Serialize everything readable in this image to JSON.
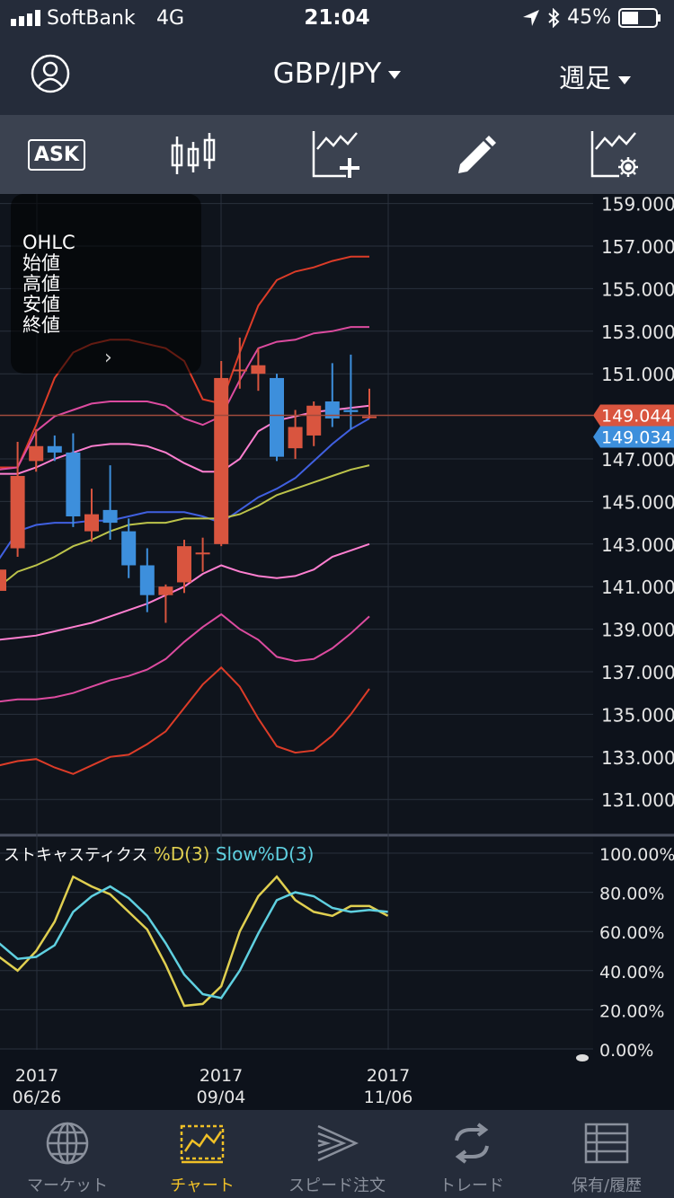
{
  "status": {
    "carrier": "SoftBank",
    "network": "4G",
    "time": "21:04",
    "battery": "45%"
  },
  "header": {
    "pair": "GBP/JPY",
    "period": "週足"
  },
  "toolbar": {
    "ask_label": "ASK"
  },
  "ohlc": {
    "title": "OHLC",
    "open": "始値",
    "high": "高値",
    "low": "安値",
    "close": "終値"
  },
  "price_axis": [
    "159.000",
    "157.000",
    "155.000",
    "153.000",
    "151.000",
    "147.000",
    "145.000",
    "143.000",
    "141.000",
    "139.000",
    "137.000",
    "135.000",
    "133.000",
    "131.000"
  ],
  "price_tags": {
    "ask": "149.044",
    "bid": "149.034",
    "ask_color": "#d9553f",
    "bid_color": "#3d8fdc"
  },
  "stoch_axis": [
    "100.00%",
    "80.00%",
    "60.00%",
    "40.00%",
    "20.00%",
    "0.00%"
  ],
  "stoch_legend": {
    "name": "ストキャスティクス",
    "k": "%D(3)",
    "d": "Slow%D(3)"
  },
  "date_labels": [
    {
      "year": "2017",
      "date": "06/26"
    },
    {
      "year": "2017",
      "date": "09/04"
    },
    {
      "year": "2017",
      "date": "11/06"
    }
  ],
  "tabs": [
    {
      "label": "マーケット",
      "icon": "globe-icon"
    },
    {
      "label": "チャート",
      "icon": "chart-icon"
    },
    {
      "label": "スピード注文",
      "icon": "speed-order-icon"
    },
    {
      "label": "トレード",
      "icon": "trade-icon"
    },
    {
      "label": "保有/履歴",
      "icon": "history-icon"
    }
  ],
  "colors": {
    "bull": "#d9553f",
    "bear": "#3d8fdc",
    "k_line": "#e0cf50",
    "d_line": "#5fd0e0"
  },
  "chart_data": [
    {
      "type": "candlestick",
      "ylim": [
        130,
        160
      ],
      "candles": [
        {
          "o": 140.8,
          "h": 142.2,
          "l": 138.5,
          "c": 141.8
        },
        {
          "o": 142.8,
          "h": 147.8,
          "l": 142.4,
          "c": 146.2
        },
        {
          "o": 146.9,
          "h": 148.4,
          "l": 146.4,
          "c": 147.6
        },
        {
          "o": 147.6,
          "h": 148.1,
          "l": 146.9,
          "c": 147.3
        },
        {
          "o": 147.3,
          "h": 148.2,
          "l": 143.8,
          "c": 144.3
        },
        {
          "o": 143.6,
          "h": 145.6,
          "l": 143.1,
          "c": 144.4
        },
        {
          "o": 144.6,
          "h": 146.7,
          "l": 143.2,
          "c": 144.0
        },
        {
          "o": 143.6,
          "h": 144.2,
          "l": 141.4,
          "c": 142.0
        },
        {
          "o": 142.0,
          "h": 142.8,
          "l": 139.8,
          "c": 140.6
        },
        {
          "o": 140.6,
          "h": 141.1,
          "l": 139.3,
          "c": 141.0
        },
        {
          "o": 141.2,
          "h": 143.2,
          "l": 140.7,
          "c": 142.9
        },
        {
          "o": 142.6,
          "h": 143.3,
          "l": 141.7,
          "c": 142.6
        },
        {
          "o": 143.0,
          "h": 151.6,
          "l": 142.9,
          "c": 150.8
        },
        {
          "o": 151.2,
          "h": 152.7,
          "l": 150.3,
          "c": 151.2
        },
        {
          "o": 151.0,
          "h": 152.2,
          "l": 150.2,
          "c": 151.4
        },
        {
          "o": 150.8,
          "h": 151.0,
          "l": 146.9,
          "c": 147.1
        },
        {
          "o": 147.5,
          "h": 149.3,
          "l": 147.0,
          "c": 148.5
        },
        {
          "o": 148.1,
          "h": 149.7,
          "l": 147.6,
          "c": 149.5
        },
        {
          "o": 149.7,
          "h": 151.5,
          "l": 148.5,
          "c": 148.9
        },
        {
          "o": 149.3,
          "h": 151.9,
          "l": 148.4,
          "c": 149.2
        },
        {
          "o": 149.0,
          "h": 150.3,
          "l": 148.9,
          "c": 149.0
        }
      ],
      "bands": [
        {
          "color": "#dc3c28",
          "values": [
            146.6,
            146.6,
            148.6,
            150.8,
            152.0,
            152.4,
            152.6,
            152.6,
            152.4,
            152.2,
            151.6,
            149.8,
            149.6,
            152.0,
            154.2,
            155.4,
            155.8,
            156.0,
            156.3,
            156.5,
            156.5
          ]
        },
        {
          "color": "#dc4b9f",
          "values": [
            146.5,
            146.6,
            148.3,
            149.0,
            149.3,
            149.6,
            149.7,
            149.7,
            149.7,
            149.5,
            148.9,
            148.6,
            149.0,
            150.7,
            152.2,
            152.5,
            152.6,
            152.9,
            153.0,
            153.2,
            153.2
          ]
        },
        {
          "color": "#ff7fd0",
          "values": [
            146.3,
            146.3,
            146.6,
            147.0,
            147.3,
            147.6,
            147.7,
            147.7,
            147.6,
            147.3,
            146.8,
            146.4,
            146.4,
            147.0,
            148.3,
            148.8,
            149.0,
            149.2,
            149.3,
            149.4,
            149.5
          ]
        },
        {
          "color": "#4060e0",
          "values": [
            142.3,
            143.6,
            143.9,
            144.0,
            144.0,
            144.1,
            144.1,
            144.3,
            144.5,
            144.5,
            144.5,
            144.3,
            144.0,
            144.6,
            145.2,
            145.6,
            146.1,
            146.9,
            147.7,
            148.4,
            148.9
          ]
        },
        {
          "color": "#bcc34a",
          "values": [
            141.0,
            141.7,
            142.0,
            142.4,
            142.9,
            143.2,
            143.6,
            143.9,
            144.0,
            144.0,
            144.2,
            144.2,
            144.2,
            144.4,
            144.8,
            145.3,
            145.6,
            145.9,
            146.2,
            146.5,
            146.7
          ]
        },
        {
          "color": "#ff7fd0",
          "values": [
            138.5,
            138.6,
            138.7,
            138.9,
            139.1,
            139.3,
            139.6,
            139.9,
            140.2,
            140.6,
            141.0,
            141.6,
            142.0,
            141.7,
            141.5,
            141.4,
            141.5,
            141.8,
            142.4,
            142.7,
            143.0
          ]
        },
        {
          "color": "#dc4b9f",
          "values": [
            135.6,
            135.7,
            135.7,
            135.8,
            136.0,
            136.3,
            136.6,
            136.8,
            137.1,
            137.6,
            138.4,
            139.1,
            139.7,
            139.0,
            138.5,
            137.7,
            137.5,
            137.6,
            138.1,
            138.8,
            139.6
          ]
        },
        {
          "color": "#dc3c28",
          "values": [
            132.6,
            132.8,
            132.9,
            132.5,
            132.2,
            132.6,
            133.0,
            133.1,
            133.6,
            134.2,
            135.3,
            136.4,
            137.2,
            136.3,
            134.8,
            133.5,
            133.2,
            133.3,
            134.0,
            135.0,
            136.2
          ]
        }
      ],
      "x_ticks": [
        "2017 06/26",
        "2017 09/04",
        "2017 11/06"
      ]
    },
    {
      "type": "line",
      "ylim": [
        0,
        100
      ],
      "series": [
        {
          "name": "%D(3)",
          "values": [
            47,
            40,
            50,
            65,
            88,
            83,
            79,
            70,
            61,
            43,
            22,
            23,
            32,
            60,
            78,
            88,
            76,
            70,
            68,
            73,
            73,
            68
          ]
        },
        {
          "name": "Slow%D(3)",
          "values": [
            54,
            46,
            47,
            53,
            70,
            78,
            83,
            77,
            68,
            54,
            38,
            28,
            26,
            40,
            59,
            76,
            80,
            78,
            72,
            70,
            71,
            70
          ]
        }
      ]
    }
  ]
}
